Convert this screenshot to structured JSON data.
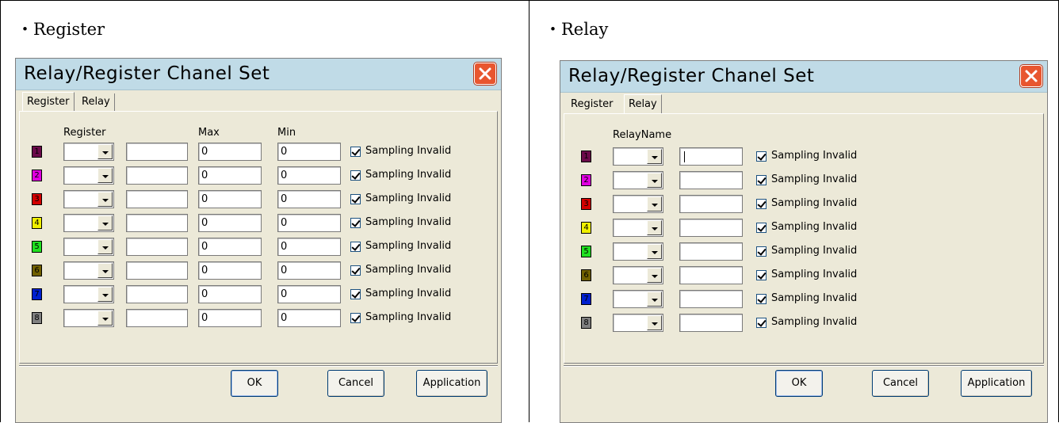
{
  "captions": {
    "register": "・Register",
    "relay": "・Relay"
  },
  "dialog": {
    "title": "Relay/Register Chanel Set",
    "tabs": [
      "Register",
      "Relay"
    ],
    "buttons": {
      "ok": "OK",
      "cancel": "Cancel",
      "application": "Application"
    }
  },
  "register_panel": {
    "headers": {
      "register": "Register",
      "max": "Max",
      "min": "Min"
    },
    "rows": [
      {
        "channel": "1",
        "register": "",
        "name": "",
        "max": "0",
        "min": "0",
        "check_label": "Sampling Invalid",
        "checked": true
      },
      {
        "channel": "2",
        "register": "",
        "name": "",
        "max": "0",
        "min": "0",
        "check_label": "Sampling Invalid",
        "checked": true
      },
      {
        "channel": "3",
        "register": "",
        "name": "",
        "max": "0",
        "min": "0",
        "check_label": "Sampling Invalid",
        "checked": true
      },
      {
        "channel": "4",
        "register": "",
        "name": "",
        "max": "0",
        "min": "0",
        "check_label": "Sampling Invalid",
        "checked": true
      },
      {
        "channel": "5",
        "register": "",
        "name": "",
        "max": "0",
        "min": "0",
        "check_label": "Sampling Invalid",
        "checked": true
      },
      {
        "channel": "6",
        "register": "",
        "name": "",
        "max": "0",
        "min": "0",
        "check_label": "Sampling Invalid",
        "checked": true
      },
      {
        "channel": "7",
        "register": "",
        "name": "",
        "max": "0",
        "min": "0",
        "check_label": "Sampling Invalid",
        "checked": true
      },
      {
        "channel": "8",
        "register": "",
        "name": "",
        "max": "0",
        "min": "0",
        "check_label": "Sampling Invalid",
        "checked": true
      }
    ]
  },
  "relay_panel": {
    "headers": {
      "relay_name": "RelayName"
    },
    "rows": [
      {
        "channel": "1",
        "relay": "",
        "name": "",
        "check_label": "Sampling Invalid",
        "checked": true
      },
      {
        "channel": "2",
        "relay": "",
        "name": "",
        "check_label": "Sampling Invalid",
        "checked": true
      },
      {
        "channel": "3",
        "relay": "",
        "name": "",
        "check_label": "Sampling Invalid",
        "checked": true
      },
      {
        "channel": "4",
        "relay": "",
        "name": "",
        "check_label": "Sampling Invalid",
        "checked": true
      },
      {
        "channel": "5",
        "relay": "",
        "name": "",
        "check_label": "Sampling Invalid",
        "checked": true
      },
      {
        "channel": "6",
        "relay": "",
        "name": "",
        "check_label": "Sampling Invalid",
        "checked": true
      },
      {
        "channel": "7",
        "relay": "",
        "name": "",
        "check_label": "Sampling Invalid",
        "checked": true
      },
      {
        "channel": "8",
        "relay": "",
        "name": "",
        "check_label": "Sampling Invalid",
        "checked": true
      }
    ]
  },
  "channel_colors": [
    "#6b0a4a",
    "#e000e0",
    "#d40000",
    "#f0f000",
    "#20e020",
    "#706000",
    "#0020d0",
    "#808080"
  ],
  "close_icon": "close-x-icon"
}
